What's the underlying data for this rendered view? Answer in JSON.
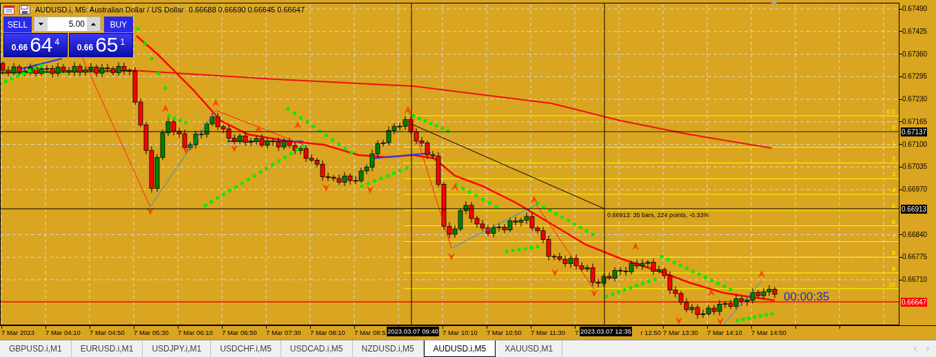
{
  "chart": {
    "title": "AUDUSD.i, M5: Australian Dollar / US Dollar",
    "ohlc": "0.66688 0.66690 0.66645 0.66647"
  },
  "trade_panel": {
    "sell_label": "SELL",
    "buy_label": "BUY",
    "volume": "5.00",
    "bid": {
      "prefix": "0.66",
      "big": "64",
      "small": "4"
    },
    "ask": {
      "prefix": "0.66",
      "big": "65",
      "small": "1"
    }
  },
  "price_axis": [
    "0.67490",
    "0.67425",
    "0.67360",
    "0.67295",
    "0.67230",
    "0.67165",
    "0.67100",
    "0.67035",
    "0.66970",
    "0.66840",
    "0.66775",
    "0.66710"
  ],
  "price_tags": [
    {
      "text": "0.67137",
      "kind": "crosshair"
    },
    {
      "text": "0.66913",
      "kind": "crosshair"
    },
    {
      "text": "0.66647",
      "kind": "bid"
    }
  ],
  "fib_levels": [
    "0.0",
    "0",
    "1",
    "2",
    "3",
    "4",
    "5",
    "6",
    "7",
    "8",
    "9",
    "10"
  ],
  "measure_label": "0.66913: 35 bars, 224 points, -0.33%",
  "timer": "00:00:35",
  "time_axis": [
    {
      "text": "7 Mar 2023",
      "clipped": false
    },
    {
      "text": "7 Mar 04:10",
      "clipped": false
    },
    {
      "text": "7 Mar 04:50",
      "clipped": false
    },
    {
      "text": "7 Mar 05:30",
      "clipped": false
    },
    {
      "text": "7 Mar 06:10",
      "clipped": false
    },
    {
      "text": "7 Mar 06:50",
      "clipped": false
    },
    {
      "text": "7 Mar 07:30",
      "clipped": false
    },
    {
      "text": "7 Mar 08:10",
      "clipped": false
    },
    {
      "text": "7 Mar 08:5",
      "clipped": false
    },
    {
      "text": "7 Mar 10:10",
      "clipped": false
    },
    {
      "text": "7 Mar 10:50",
      "clipped": false
    },
    {
      "text": "7 Mar 11:30",
      "clipped": false
    },
    {
      "text": "7",
      "clipped": false
    },
    {
      "text": "r 12:50",
      "clipped": true
    },
    {
      "text": "7 Mar 13:30",
      "clipped": false
    },
    {
      "text": "7 Mar 14:10",
      "clipped": false
    },
    {
      "text": "7 Mar 14:50",
      "clipped": false
    }
  ],
  "crosshair_times": [
    "2023.03.07 09:40",
    "2023.03.07 12:35"
  ],
  "tabs": [
    {
      "label": "GBPUSD.i,M1",
      "selected": false
    },
    {
      "label": "EURUSD.i,M1",
      "selected": false
    },
    {
      "label": "USDJPY.i,M1",
      "selected": false
    },
    {
      "label": "USDCHF.i,M5",
      "selected": false
    },
    {
      "label": "USDCAD.i,M5",
      "selected": false
    },
    {
      "label": "NZDUSD.i,M5",
      "selected": false
    },
    {
      "label": "AUDUSD.i,M5",
      "selected": true
    },
    {
      "label": "XAUUSD,M1",
      "selected": false
    }
  ]
}
